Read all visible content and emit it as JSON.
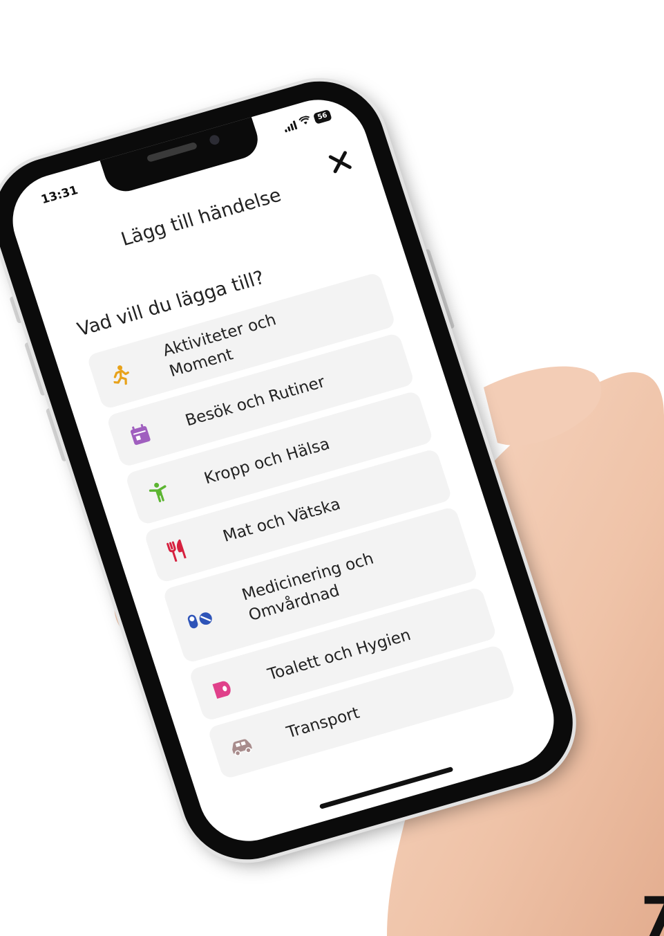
{
  "status_bar": {
    "time": "13:31",
    "battery": "56"
  },
  "sheet": {
    "title": "Lägg till händelse",
    "question": "Vad vill du lägga till?",
    "close_icon": "close-icon"
  },
  "categories": [
    {
      "label": "Aktiviteter och Moment",
      "icon": "running-person-icon",
      "color": "#e8a21a"
    },
    {
      "label": "Besök och Rutiner",
      "icon": "calendar-icon",
      "color": "#a05fbf"
    },
    {
      "label": "Kropp och Hälsa",
      "icon": "child-figure-icon",
      "color": "#5cb531"
    },
    {
      "label": "Mat och Vätska",
      "icon": "fork-knife-icon",
      "color": "#d6213f"
    },
    {
      "label": "Medicinering och Omvårdnad",
      "icon": "pills-icon",
      "color": "#2e54b8"
    },
    {
      "label": "Toalett och Hygien",
      "icon": "toilet-paper-icon",
      "color": "#e0408a"
    },
    {
      "label": "Transport",
      "icon": "car-icon",
      "color": "#a88c8c"
    }
  ],
  "corner_mark": "7"
}
